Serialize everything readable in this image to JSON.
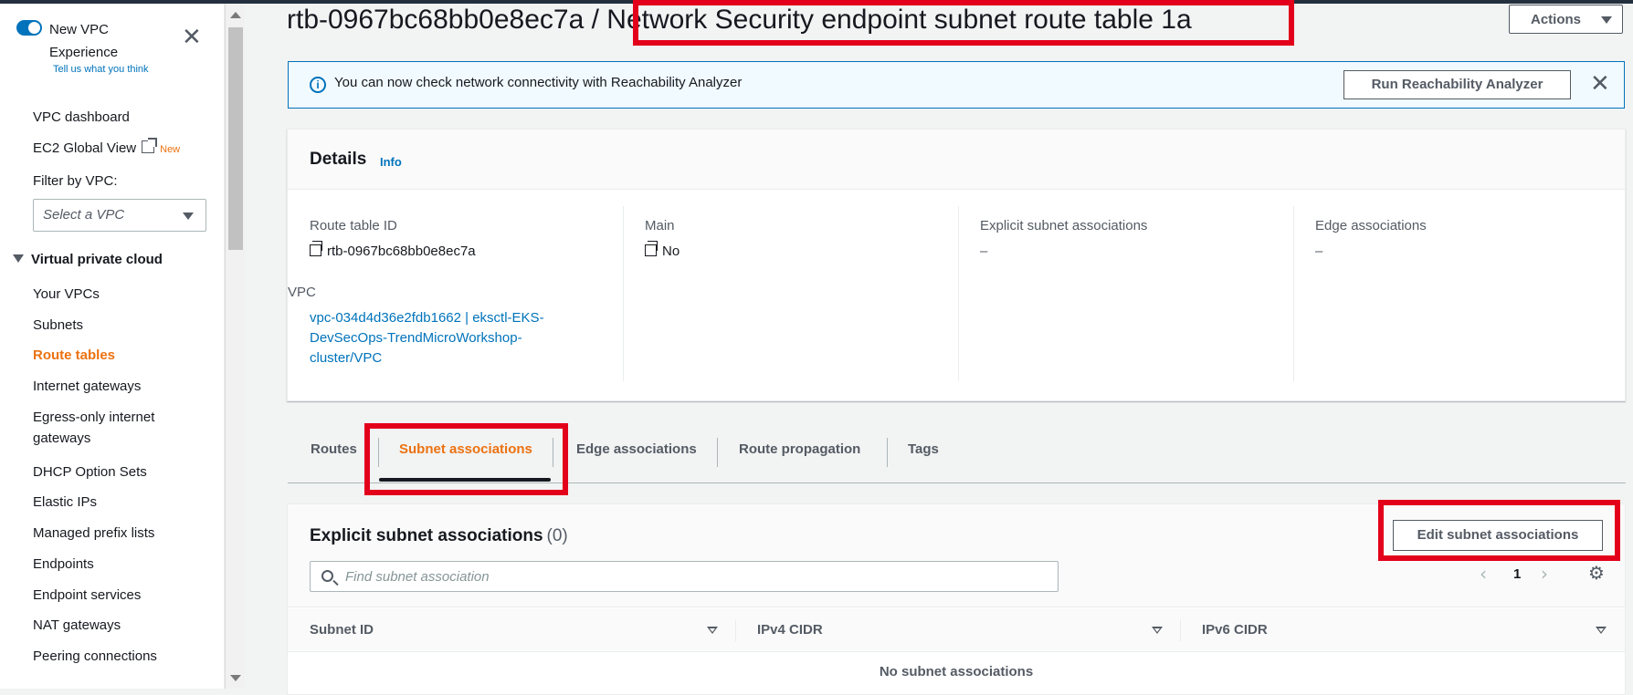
{
  "sidebar": {
    "experience_title": "New VPC Experience",
    "experience_link": "Tell us what you think",
    "vpc_dashboard": "VPC dashboard",
    "ec2_global_view": "EC2 Global View",
    "new_badge": "New",
    "filter_label": "Filter by VPC:",
    "vpc_select_placeholder": "Select a VPC",
    "section_header": "Virtual private cloud",
    "items": [
      {
        "label": "Your VPCs"
      },
      {
        "label": "Subnets"
      },
      {
        "label": "Route tables"
      },
      {
        "label": "Internet gateways"
      },
      {
        "label": "Egress-only internet gateways"
      },
      {
        "label": "DHCP Option Sets"
      },
      {
        "label": "Elastic IPs"
      },
      {
        "label": "Managed prefix lists"
      },
      {
        "label": "Endpoints"
      },
      {
        "label": "Endpoint services"
      },
      {
        "label": "NAT gateways"
      },
      {
        "label": "Peering connections"
      }
    ],
    "active_item": "Route tables"
  },
  "header": {
    "title": "rtb-0967bc68bb0e8ec7a / Network Security endpoint subnet route table 1a",
    "actions_label": "Actions"
  },
  "flash": {
    "message": "You can now check network connectivity with Reachability Analyzer",
    "button_label": "Run Reachability Analyzer"
  },
  "details": {
    "title": "Details",
    "info_label": "Info",
    "route_table_id_label": "Route table ID",
    "route_table_id": "rtb-0967bc68bb0e8ec7a",
    "main_label": "Main",
    "main_value": "No",
    "explicit_label": "Explicit subnet associations",
    "explicit_value": "–",
    "edge_label": "Edge associations",
    "edge_value": "–",
    "vpc_label": "VPC",
    "vpc_value": "vpc-034d4d36e2fdb1662 | eksctl-EKS-DevSecOps-TrendMicroWorkshop-cluster/VPC"
  },
  "tabs": [
    {
      "label": "Routes"
    },
    {
      "label": "Subnet associations"
    },
    {
      "label": "Edge associations"
    },
    {
      "label": "Route propagation"
    },
    {
      "label": "Tags"
    }
  ],
  "associations": {
    "title": "Explicit subnet associations",
    "count": "(0)",
    "edit_button": "Edit subnet associations",
    "search_placeholder": "Find subnet association",
    "page": "1",
    "columns": [
      "Subnet ID",
      "IPv4 CIDR",
      "IPv6 CIDR"
    ],
    "empty_message": "No subnet associations"
  },
  "colors": {
    "accent": "#0073bb",
    "active": "#ec7211",
    "highlight": "#e3001b"
  },
  "icons": [
    "toggle-icon",
    "close-icon",
    "external-link-icon",
    "caret-down-icon",
    "info-icon",
    "copy-icon",
    "search-icon",
    "chevron-left-icon",
    "chevron-right-icon",
    "gear-icon"
  ]
}
